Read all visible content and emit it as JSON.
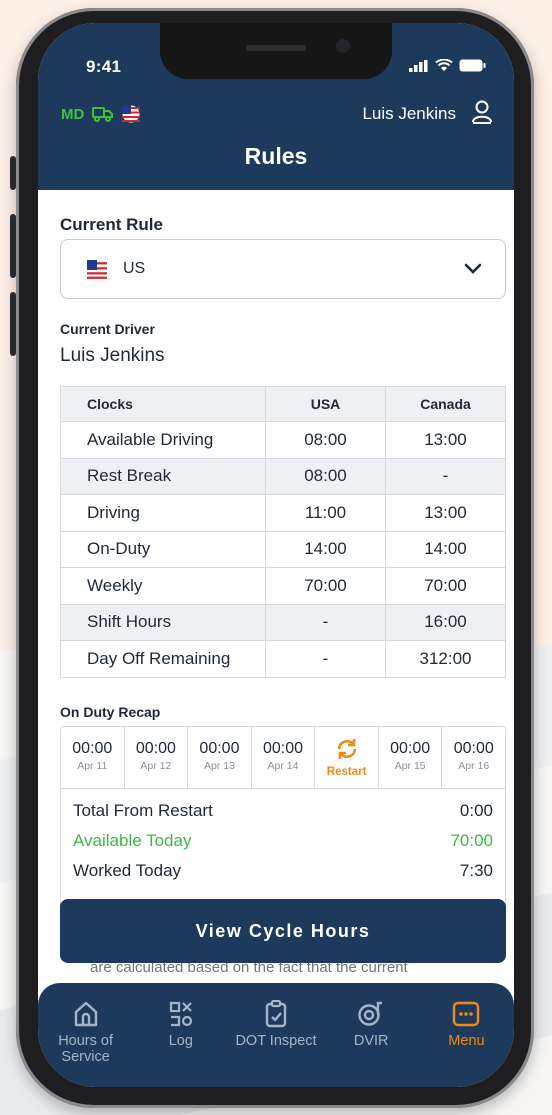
{
  "status_bar": {
    "time": "9:41"
  },
  "header": {
    "state_code": "MD",
    "user_name": "Luis Jenkins",
    "title": "Rules"
  },
  "current_rule": {
    "label": "Current Rule",
    "selected": "US"
  },
  "current_driver": {
    "label": "Current Driver",
    "name": "Luis Jenkins"
  },
  "clocks_table": {
    "headers": [
      "Clocks",
      "USA",
      "Canada"
    ],
    "rows": [
      {
        "name": "Available Driving",
        "usa": "08:00",
        "canada": "13:00"
      },
      {
        "name": "Rest Break",
        "usa": "08:00",
        "canada": "-"
      },
      {
        "name": "Driving",
        "usa": "11:00",
        "canada": "13:00"
      },
      {
        "name": "On-Duty",
        "usa": "14:00",
        "canada": "14:00"
      },
      {
        "name": "Weekly",
        "usa": "70:00",
        "canada": "70:00"
      },
      {
        "name": "Shift Hours",
        "usa": "-",
        "canada": "16:00"
      },
      {
        "name": "Day Off Remaining",
        "usa": "-",
        "canada": "312:00"
      }
    ]
  },
  "recap": {
    "label": "On Duty Recap",
    "days": [
      {
        "hours": "00:00",
        "date": "Apr 11"
      },
      {
        "hours": "00:00",
        "date": "Apr 12"
      },
      {
        "hours": "00:00",
        "date": "Apr 13"
      },
      {
        "hours": "00:00",
        "date": "Apr 14"
      },
      {
        "restart_label": "Restart"
      },
      {
        "hours": "00:00",
        "date": "Apr 15"
      },
      {
        "hours": "00:00",
        "date": "Apr 16"
      }
    ],
    "summary": [
      {
        "label": "Total From Restart",
        "value": "0:00"
      },
      {
        "label": "Available Today",
        "value": "70:00"
      },
      {
        "label": "Worked Today",
        "value": "7:30"
      }
    ]
  },
  "view_cycle_button": "View Cycle Hours",
  "note_text": "are calculated based on the fact that the current",
  "tabs": [
    {
      "label": "Hours of Service",
      "icon": "home-icon"
    },
    {
      "label": "Log",
      "icon": "log-icon"
    },
    {
      "label": "DOT Inspect",
      "icon": "clipboard-check-icon"
    },
    {
      "label": "DVIR",
      "icon": "tire-icon"
    },
    {
      "label": "Menu",
      "icon": "menu-icon"
    }
  ],
  "colors": {
    "primary": "#1d3a5c",
    "accent": "#f08a14",
    "green": "#3db848"
  }
}
